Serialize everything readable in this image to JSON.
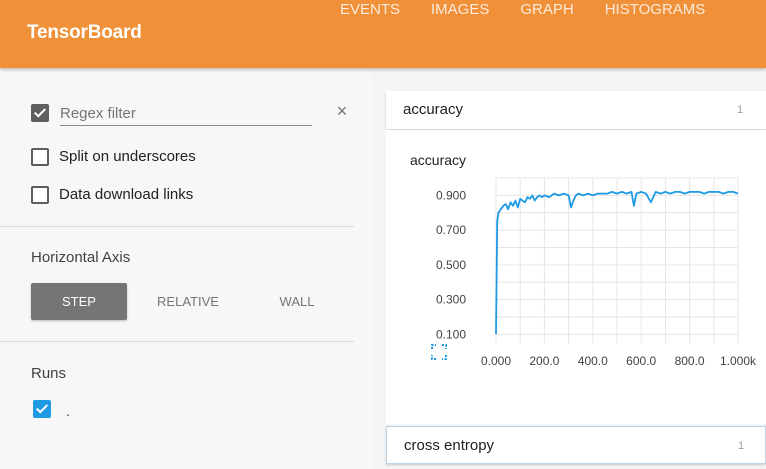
{
  "app": {
    "title": "TensorBoard"
  },
  "nav": {
    "tabs": [
      "EVENTS",
      "IMAGES",
      "GRAPH",
      "HISTOGRAMS"
    ]
  },
  "colors": {
    "brand": "#f0913a",
    "series": "#1f9be6",
    "active_button": "#757575"
  },
  "sidebar": {
    "regex": {
      "placeholder": "Regex filter",
      "value": "",
      "checked": true,
      "clear_icon": "close-icon"
    },
    "options": [
      {
        "label": "Split on underscores",
        "checked": false
      },
      {
        "label": "Data download links",
        "checked": false
      }
    ],
    "horizontal_axis": {
      "title": "Horizontal Axis",
      "buttons": [
        "STEP",
        "RELATIVE",
        "WALL"
      ],
      "selected": "STEP"
    },
    "runs": {
      "title": "Runs",
      "items": [
        {
          "label": ".",
          "checked": true
        }
      ]
    }
  },
  "cards": [
    {
      "title": "accuracy",
      "count": "1"
    },
    {
      "title": "cross entropy",
      "count": "1"
    }
  ],
  "chart_data": {
    "type": "line",
    "title": "accuracy",
    "xlabel": "",
    "ylabel": "",
    "xlim": [
      0,
      1000
    ],
    "ylim": [
      0.05,
      1.0
    ],
    "x_ticks": [
      0,
      200,
      400,
      600,
      800,
      1000
    ],
    "x_tick_labels": [
      "0.000",
      "200.0",
      "400.0",
      "600.0",
      "800.0",
      "1.000k"
    ],
    "y_ticks": [
      0.1,
      0.3,
      0.5,
      0.7,
      0.9
    ],
    "y_tick_labels": [
      "0.100",
      "0.300",
      "0.500",
      "0.700",
      "0.900"
    ],
    "grid": true,
    "series": [
      {
        "color": "#1f9be6",
        "x": [
          0,
          5,
          10,
          20,
          30,
          40,
          50,
          60,
          70,
          80,
          90,
          100,
          110,
          120,
          130,
          140,
          150,
          160,
          170,
          180,
          190,
          200,
          220,
          240,
          260,
          280,
          300,
          310,
          320,
          330,
          340,
          360,
          380,
          400,
          420,
          440,
          460,
          480,
          500,
          520,
          540,
          560,
          570,
          580,
          600,
          620,
          640,
          660,
          680,
          700,
          720,
          740,
          760,
          780,
          800,
          820,
          840,
          860,
          880,
          900,
          920,
          940,
          960,
          980,
          1000
        ],
        "values": [
          0.1,
          0.75,
          0.8,
          0.82,
          0.84,
          0.85,
          0.82,
          0.86,
          0.84,
          0.87,
          0.83,
          0.88,
          0.87,
          0.86,
          0.89,
          0.88,
          0.9,
          0.87,
          0.89,
          0.9,
          0.89,
          0.9,
          0.89,
          0.91,
          0.9,
          0.91,
          0.9,
          0.83,
          0.87,
          0.9,
          0.91,
          0.9,
          0.91,
          0.9,
          0.91,
          0.91,
          0.91,
          0.92,
          0.91,
          0.92,
          0.91,
          0.92,
          0.84,
          0.91,
          0.92,
          0.91,
          0.86,
          0.92,
          0.91,
          0.92,
          0.91,
          0.92,
          0.92,
          0.91,
          0.92,
          0.92,
          0.92,
          0.91,
          0.92,
          0.92,
          0.92,
          0.91,
          0.92,
          0.92,
          0.91
        ]
      }
    ]
  }
}
